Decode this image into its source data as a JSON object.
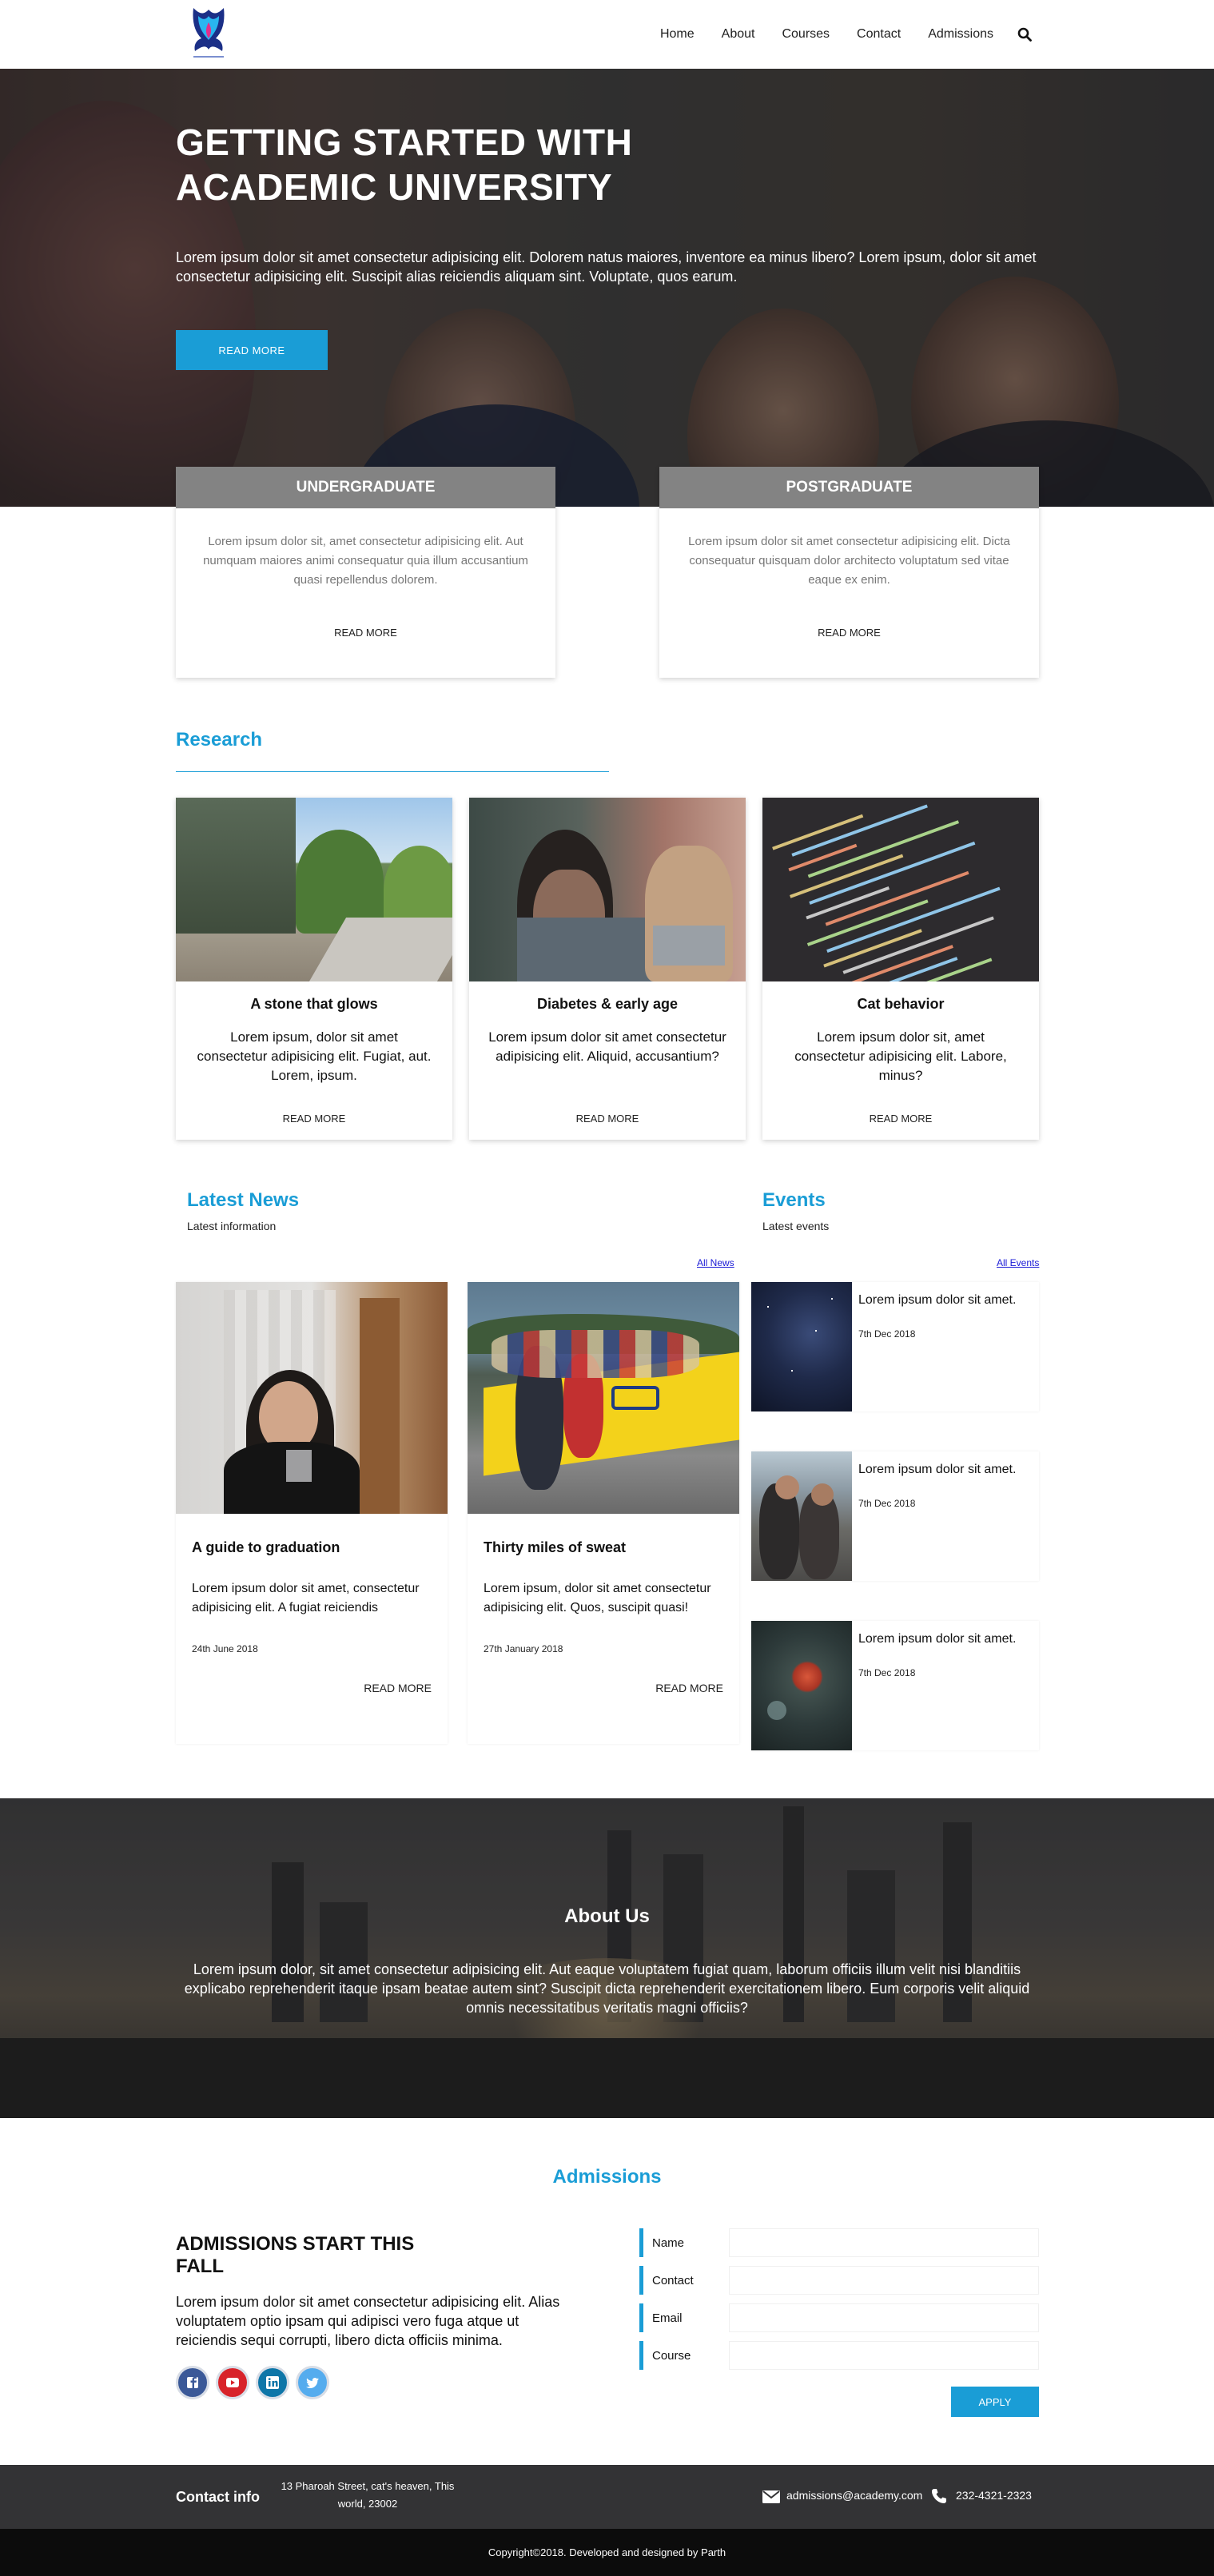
{
  "nav": {
    "links": [
      "Home",
      "About",
      "Courses",
      "Contact",
      "Admissions"
    ],
    "search_icon": "search-icon"
  },
  "hero": {
    "title": "GETTING STARTED WITH ACADEMIC UNIVERSITY",
    "text": "Lorem ipsum dolor sit amet consectetur adipisicing elit. Dolorem natus maiores, inventore ea minus libero? Lorem ipsum, dolor sit amet consectetur adipisicing elit. Suscipit alias reiciendis aliquam sint. Voluptate, quos earum.",
    "button": "READ MORE"
  },
  "programs": [
    {
      "title": "UNDERGRADUATE",
      "text": "Lorem ipsum dolor sit, amet consectetur adipisicing elit. Aut numquam maiores animi consequatur quia illum accusantium quasi repellendus dolorem.",
      "link": "READ MORE"
    },
    {
      "title": "POSTGRADUATE",
      "text": "Lorem ipsum dolor sit amet consectetur adipisicing elit. Dicta consequatur quisquam dolor architecto voluptatum sed vitae eaque ex enim.",
      "link": "READ MORE"
    }
  ],
  "research": {
    "title": "Research",
    "cards": [
      {
        "title": "A stone that glows",
        "text": "Lorem ipsum, dolor sit amet consectetur adipisicing elit. Fugiat, aut. Lorem, ipsum.",
        "link": "READ MORE"
      },
      {
        "title": "Diabetes & early age",
        "text": "Lorem ipsum dolor sit amet consectetur adipisicing elit. Aliquid, accusantium?",
        "link": "READ MORE"
      },
      {
        "title": "Cat behavior",
        "text": "Lorem ipsum dolor sit, amet consectetur adipisicing elit. Labore, minus?",
        "link": "READ MORE"
      }
    ]
  },
  "news": {
    "title": "Latest News",
    "subtitle": "Latest information",
    "all_link": "All News",
    "items": [
      {
        "title": "A guide to graduation",
        "text": "Lorem ipsum dolor sit amet, consectetur adipisicing elit. A fugiat reiciendis",
        "date": "24th June 2018",
        "link": "READ MORE"
      },
      {
        "title": "Thirty miles of sweat",
        "text": "Lorem ipsum, dolor sit amet consectetur adipisicing elit. Quos, suscipit quasi!",
        "date": "27th January 2018",
        "link": "READ MORE"
      }
    ]
  },
  "events": {
    "title": "Events",
    "subtitle": "Latest events",
    "all_link": "All Events",
    "items": [
      {
        "title": "Lorem ipsum dolor sit amet.",
        "date": "7th Dec 2018"
      },
      {
        "title": "Lorem ipsum dolor sit amet.",
        "date": "7th Dec 2018"
      },
      {
        "title": "Lorem ipsum dolor sit amet.",
        "date": "7th Dec 2018"
      }
    ]
  },
  "about": {
    "title": "About Us",
    "text": "Lorem ipsum dolor, sit amet consectetur adipisicing elit. Aut eaque voluptatem fugiat quam, laborum officiis illum velit nisi blanditiis explicabo reprehenderit itaque ipsam beatae autem sint? Suscipit dicta reprehenderit exercitationem libero. Eum corporis velit aliquid omnis necessitatibus veritatis magni officiis?"
  },
  "admissions": {
    "title": "Admissions",
    "heading": "ADMISSIONS START THIS FALL",
    "text": "Lorem ipsum dolor sit amet consectetur adipisicing elit. Alias voluptatem optio ipsam qui adipisci vero fuga atque ut reiciendis sequi corrupti, libero dicta officiis minima.",
    "social_icons": [
      "facebook-icon",
      "youtube-icon",
      "linkedin-icon",
      "twitter-icon"
    ],
    "form": {
      "fields": [
        "Name",
        "Contact",
        "Email",
        "Course"
      ],
      "button": "APPLY"
    }
  },
  "footer": {
    "label": "Contact info",
    "address": "13 Pharoah Street, cat's heaven, This world, 23002",
    "email": "admissions@academy.com",
    "phone": "232-4321-2323",
    "copyright": "Copyright©2018. Developed and designed by Parth"
  },
  "colors": {
    "accent": "#1a9dd6",
    "footer": "#333335",
    "copyright_bar": "#0c0c0c"
  }
}
